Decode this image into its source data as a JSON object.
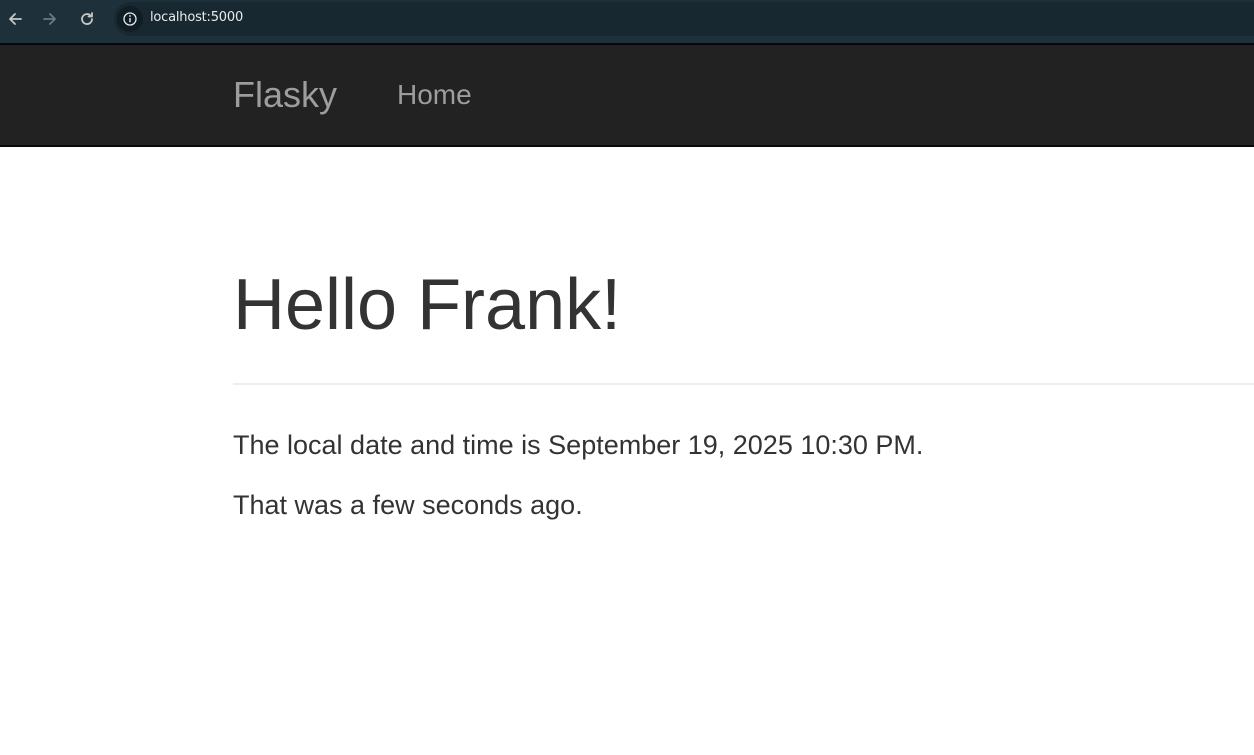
{
  "browser": {
    "url": "localhost:5000",
    "icons": {
      "back": "arrow-left-icon",
      "forward": "arrow-right-icon",
      "reload": "reload-icon",
      "site_info": "info-icon"
    }
  },
  "navbar": {
    "brand": "Flasky",
    "items": [
      {
        "label": "Home"
      }
    ]
  },
  "main": {
    "heading": "Hello Frank!",
    "date_line": "The local date and time is September 19, 2025 10:30 PM.",
    "ago_line": "That was a few seconds ago."
  },
  "colors": {
    "navbar_bg": "#222222",
    "navbar_text": "#9d9d9d",
    "body_text": "#333333",
    "browser_bar": "#1e3039"
  }
}
